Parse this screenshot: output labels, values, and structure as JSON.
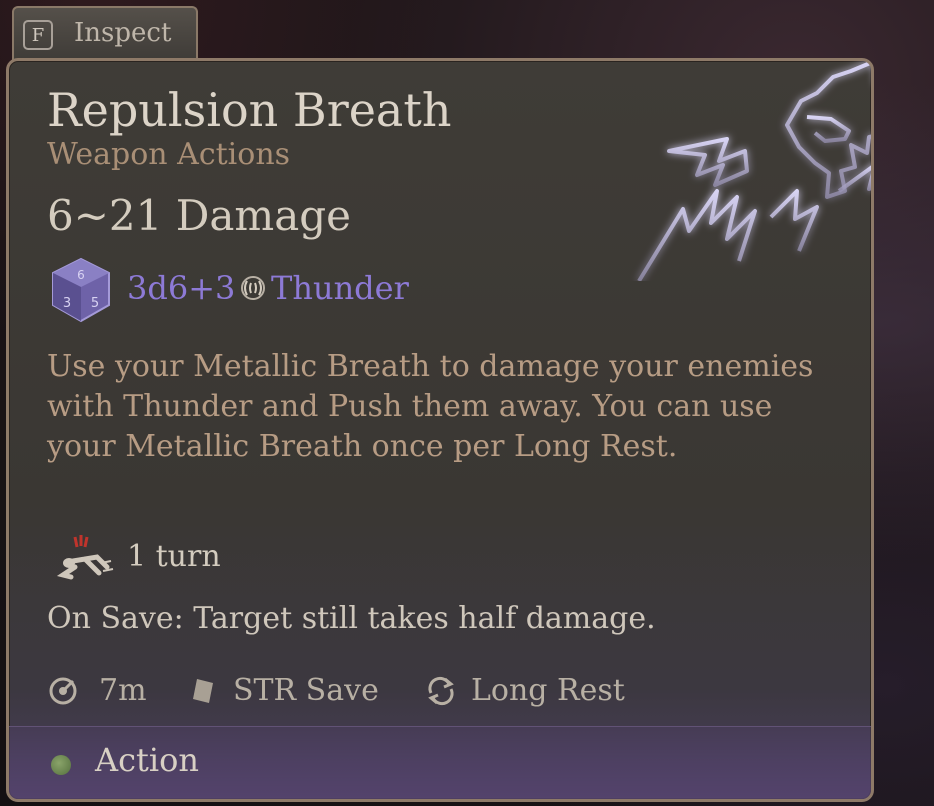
{
  "inspect": {
    "key": "F",
    "label": "Inspect"
  },
  "spell": {
    "name": "Repulsion Breath",
    "category": "Weapon Actions",
    "damage_summary": "6~21 Damage",
    "dice": "3d6+3",
    "damage_type": "Thunder",
    "description": "Use your Metallic Breath to damage your enemies with Thunder and Push them away. You can use your Metallic Breath once per Long Rest.",
    "duration": "1 turn",
    "on_save": "On Save: Target still takes half damage.",
    "range": "7m",
    "save": "STR Save",
    "recharge": "Long Rest",
    "cost": "Action"
  },
  "colors": {
    "accent_purple": "#8d7ad6",
    "title": "#dcd4c8",
    "subtitle": "#a98f76",
    "description": "#b79c84",
    "action_dot": "#6f8c52"
  },
  "icons": {
    "emblem": "dragon-lightning-icon",
    "die": "d6-die-icon",
    "damage_type": "thunder-icon",
    "duration": "prone-icon",
    "range": "range-icon",
    "save": "save-icon",
    "recharge": "long-rest-icon",
    "cost": "action-dot-icon"
  }
}
